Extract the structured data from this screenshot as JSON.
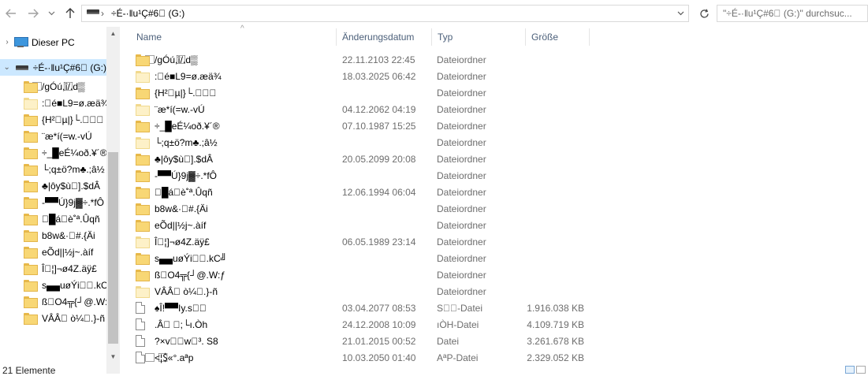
{
  "nav": {
    "back_icon": "arrow-left-icon",
    "forward_icon": "arrow-right-icon",
    "recent_icon": "chevron-down-icon",
    "up_icon": "arrow-up-icon"
  },
  "address": {
    "separator": "›",
    "path": "÷É-·‖u¹Ç#6⃞ (G:)",
    "dropdown_icon": "chevron-down-icon",
    "refresh_icon": "refresh-icon"
  },
  "search": {
    "placeholder": "\"÷É-·‖u¹Ç#6⃞ (G:)\" durchsuc..."
  },
  "sidebar": {
    "this_pc": "Dieser PC",
    "drive": "÷É-·‖u¹Ç#6⃞ (G:)",
    "folders": [
      "⃞/gÓú,î/.⃞d▒",
      ":⃞é■L9=ø.æä¾",
      "{H²⃞µ|}└.⃞⃞⃞",
      "¨æ*í(=w.-vÚ",
      "÷_█eÉ¼oð.¥´®",
      "└;q±ö?m♣.;â½",
      "♣|ôy$ù⃞].$dÂ",
      "-▀▀Ú}9j▓÷.*fÔ",
      "⃞█á⃞è˚ª.Ûqñ",
      "b8w&·⃞#.{Äi",
      "eÕd||½j~.àíf",
      "Î⃞¦]¬ø4Z.äÿ£",
      "s▄▄uøÝi⃞⃞.kC╝",
      "ß⃞O4╦{┘@.W:ƒ",
      "VÂÂ⃞ ò¼⃞.}-ñ"
    ]
  },
  "columns": {
    "name": "Name",
    "date": "Änderungsdatum",
    "type": "Typ",
    "size": "Größe"
  },
  "files": [
    {
      "name": "⃞/gÓú,î/.⃞d▒",
      "date": "22.11.2103 22:45",
      "type": "Dateiordner",
      "size": "",
      "kind": "folder"
    },
    {
      "name": ":⃞é■L9=ø.æä¾",
      "date": "18.03.2025 06:42",
      "type": "Dateiordner",
      "size": "",
      "kind": "folder-light"
    },
    {
      "name": "{H²⃞µ|}└.⃞⃞⃞",
      "date": "",
      "type": "Dateiordner",
      "size": "",
      "kind": "folder"
    },
    {
      "name": "¨æ*í(=w.-vÚ",
      "date": "04.12.2062 04:19",
      "type": "Dateiordner",
      "size": "",
      "kind": "folder-light"
    },
    {
      "name": "÷_█eÉ¼oð.¥´®",
      "date": "07.10.1987 15:25",
      "type": "Dateiordner",
      "size": "",
      "kind": "folder"
    },
    {
      "name": "└;q±ö?m♣.;â½",
      "date": "",
      "type": "Dateiordner",
      "size": "",
      "kind": "folder-light"
    },
    {
      "name": "♣|ôy$ù⃞].$dÂ",
      "date": "20.05.2099 20:08",
      "type": "Dateiordner",
      "size": "",
      "kind": "folder"
    },
    {
      "name": "-▀▀Ú}9j▓÷.*fÔ",
      "date": "",
      "type": "Dateiordner",
      "size": "",
      "kind": "folder"
    },
    {
      "name": "⃞█á⃞è˚ª.Ûqñ",
      "date": "12.06.1994 06:04",
      "type": "Dateiordner",
      "size": "",
      "kind": "folder"
    },
    {
      "name": "b8w&·⃞#.{Äi",
      "date": "",
      "type": "Dateiordner",
      "size": "",
      "kind": "folder"
    },
    {
      "name": "eÕd||½j~.àíf",
      "date": "",
      "type": "Dateiordner",
      "size": "",
      "kind": "folder"
    },
    {
      "name": "Î⃞¦]¬ø4Z.äÿ£",
      "date": "06.05.1989 23:14",
      "type": "Dateiordner",
      "size": "",
      "kind": "folder-light"
    },
    {
      "name": "s▄▄uøÝi⃞⃞.kC╝",
      "date": "",
      "type": "Dateiordner",
      "size": "",
      "kind": "folder"
    },
    {
      "name": "ß⃞O4╦{┘@.W:ƒ",
      "date": "",
      "type": "Dateiordner",
      "size": "",
      "kind": "folder"
    },
    {
      "name": "VÂÂ⃞ ò¼⃞.}-ñ",
      "date": "",
      "type": "Dateiordner",
      "size": "",
      "kind": "folder-light"
    },
    {
      "name": "♠Î!▀▀Iy.s⃞⃞",
      "date": "03.04.2077 08:53",
      "type": "S⃞⃞-Datei",
      "size": "1.916.038 KB",
      "kind": "file"
    },
    {
      "name": ".Â⃞ ⃞;└ı.Òh",
      "date": "24.12.2008 10:09",
      "type": "ıÒH-Datei",
      "size": "4.109.719 KB",
      "kind": "file"
    },
    {
      "name": "?×v⃞⃞w⃞³. S8",
      "date": "21.01.2015 00:52",
      "type": "Datei",
      "size": "3.261.678 KB",
      "kind": "file"
    },
    {
      "name": "⃞<¦$⃞«°.aªp",
      "date": "10.03.2050 01:40",
      "type": "AªP-Datei",
      "size": "2.329.052 KB",
      "kind": "file"
    }
  ],
  "status": {
    "count": "21 Elemente"
  }
}
